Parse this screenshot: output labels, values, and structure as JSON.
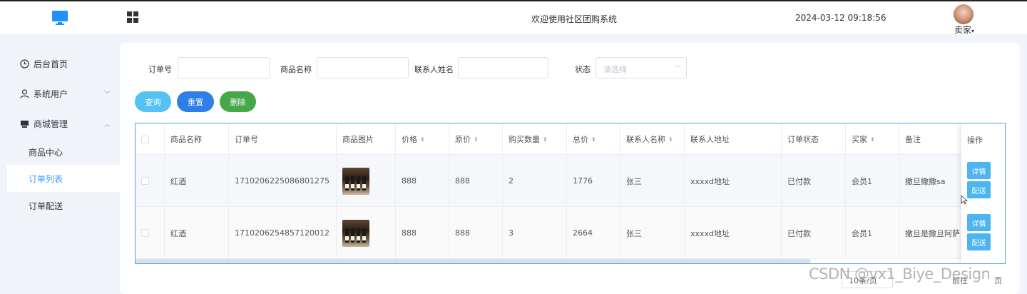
{
  "header": {
    "title": "欢迎使用社区团购系统",
    "datetime": "2024-03-12 09:18:56",
    "user": "卖家",
    "brand_color": "#1e90ff"
  },
  "sidebar": {
    "items": [
      {
        "label": "后台首页",
        "icon": "clock-icon"
      },
      {
        "label": "系统用户",
        "icon": "user-icon"
      },
      {
        "label": "商城管理",
        "icon": "shop-icon"
      }
    ],
    "sub": [
      {
        "label": "商品中心"
      },
      {
        "label": "订单列表"
      },
      {
        "label": "订单配送"
      }
    ]
  },
  "filters": {
    "order_no": {
      "label": "订单号",
      "value": ""
    },
    "product_name": {
      "label": "商品名称",
      "value": ""
    },
    "contact_name": {
      "label": "联系人姓名",
      "value": ""
    },
    "status": {
      "label": "状态",
      "placeholder": "请选择"
    }
  },
  "actions": {
    "query": "查询",
    "reset": "重置",
    "delete": "删除"
  },
  "table": {
    "columns": [
      "商品名称",
      "订单号",
      "商品图片",
      "价格",
      "原价",
      "购买数量",
      "总价",
      "联系人名称",
      "联系人地址",
      "订单状态",
      "买家",
      "备注",
      "操作"
    ],
    "rows": [
      {
        "name": "红酒",
        "order_no": "1710206225086801275",
        "price": "888",
        "orig": "888",
        "qty": "2",
        "total": "1776",
        "contact": "张三",
        "addr": "xxxxd地址",
        "status": "已付款",
        "buyer": "会员1",
        "note": "撒旦撒撒sa"
      },
      {
        "name": "红酒",
        "order_no": "1710206254857120012",
        "price": "888",
        "orig": "888",
        "qty": "3",
        "total": "2664",
        "contact": "张三",
        "addr": "xxxxd地址",
        "status": "已付款",
        "buyer": "会员1",
        "note": "撒旦是撒旦阿萨"
      }
    ],
    "row_actions": {
      "detail": "详情",
      "deliver": "配送"
    }
  },
  "pagination": {
    "total": "10条/页",
    "goto": "前往",
    "page": "页"
  },
  "watermark": "CSDN @vx1_Biye_Design"
}
